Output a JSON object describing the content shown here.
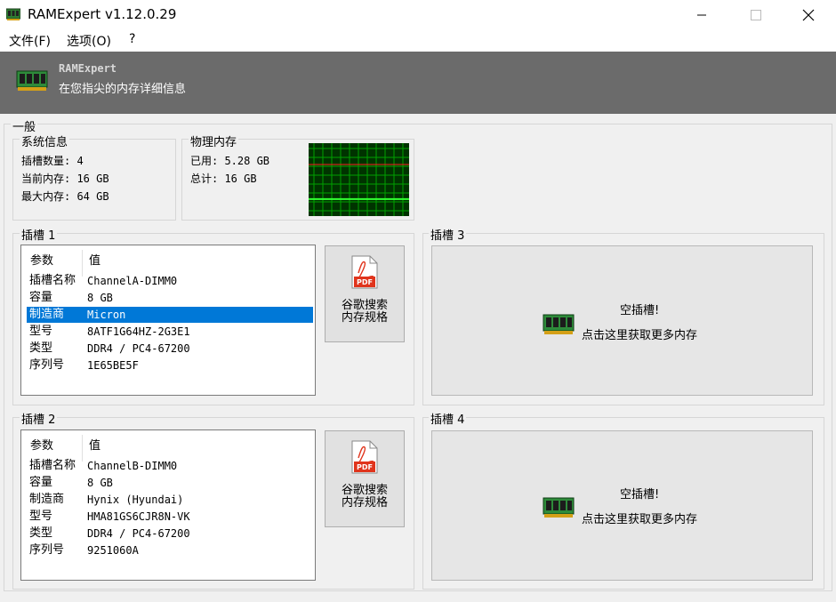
{
  "window": {
    "title": "RAMExpert v1.12.0.29"
  },
  "menu": {
    "file": "文件(F)",
    "options": "选项(O)",
    "help": "?"
  },
  "banner": {
    "title": "RAMExpert",
    "subtitle": "在您指尖的内存详细信息"
  },
  "general": {
    "legend": "一般",
    "system": {
      "legend": "系统信息",
      "rows": [
        "插槽数量: 4",
        "当前内存: 16 GB",
        "最大内存: 64 GB"
      ]
    },
    "physical": {
      "legend": "物理内存",
      "used": "已用: 5.28 GB",
      "total": "总计: 16 GB",
      "usage_fraction": 0.33
    }
  },
  "slots": [
    {
      "legend": "插槽 1",
      "header_param": "参数",
      "header_value": "值",
      "rows": [
        {
          "k": "插槽名称",
          "v": "ChannelA-DIMM0"
        },
        {
          "k": "容量",
          "v": "8 GB"
        },
        {
          "k": "制造商",
          "v": "Micron"
        },
        {
          "k": "型号",
          "v": "8ATF1G64HZ-2G3E1"
        },
        {
          "k": "类型",
          "v": "DDR4 / PC4-67200"
        },
        {
          "k": "序列号",
          "v": "1E65BE5F"
        }
      ],
      "selected_row": 2,
      "button_line1": "谷歌搜索",
      "button_line2": "内存规格"
    },
    {
      "legend": "插槽 2",
      "header_param": "参数",
      "header_value": "值",
      "rows": [
        {
          "k": "插槽名称",
          "v": "ChannelB-DIMM0"
        },
        {
          "k": "容量",
          "v": "8 GB"
        },
        {
          "k": "制造商",
          "v": "Hynix (Hyundai)"
        },
        {
          "k": "型号",
          "v": "HMA81GS6CJR8N-VK"
        },
        {
          "k": "类型",
          "v": "DDR4 / PC4-67200"
        },
        {
          "k": "序列号",
          "v": "9251060A"
        }
      ],
      "button_line1": "谷歌搜索",
      "button_line2": "内存规格"
    },
    {
      "legend": "插槽 3",
      "line1": "空插槽!",
      "line2": "点击这里获取更多内存"
    },
    {
      "legend": "插槽 4",
      "line1": "空插槽!",
      "line2": "点击这里获取更多内存"
    }
  ],
  "pdf_icon_text": "PDF",
  "colors": {
    "banner": "#6b6b6b",
    "selection": "#0078d7",
    "graph_bg": "#003300",
    "graph_grid": "#00a000",
    "graph_total": "#ff2020",
    "graph_used": "#33ff33"
  },
  "icons": {
    "app": "ram-module-icon",
    "pdf": "pdf-icon",
    "slot": "ram-module-icon"
  }
}
